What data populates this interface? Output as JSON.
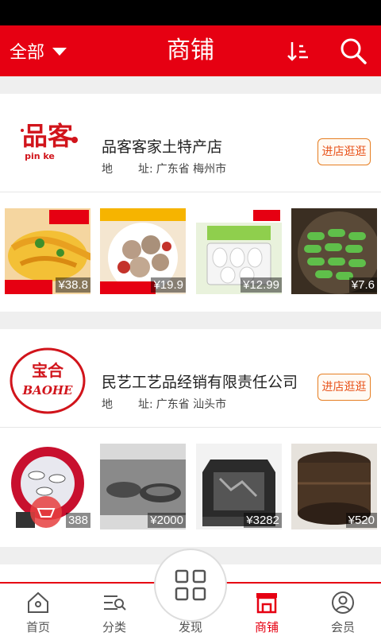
{
  "header": {
    "filter_label": "全部",
    "title": "商铺"
  },
  "shops": [
    {
      "name": "品客客家土特产店",
      "addr_label_1": "地",
      "addr_label_2": "址:",
      "address": "广东省 梅州市",
      "visit_label": "进店逛逛",
      "logo_text": "品客",
      "logo_sub": "pin ke",
      "products": [
        {
          "price": "¥38.8"
        },
        {
          "price": "¥19.9"
        },
        {
          "price": "¥12.99"
        },
        {
          "price": "¥7.6"
        }
      ]
    },
    {
      "name": "民艺工艺品经销有限责任公司",
      "addr_label_1": "地",
      "addr_label_2": "址:",
      "address": "广东省 汕头市",
      "visit_label": "进店逛逛",
      "logo_text": "宝合",
      "logo_sub": "BAOHE",
      "products": [
        {
          "price": "388"
        },
        {
          "price": "¥2000"
        },
        {
          "price": "¥3282"
        },
        {
          "price": "¥520"
        }
      ]
    }
  ],
  "tabs": [
    {
      "label": "首页",
      "icon": "home-icon"
    },
    {
      "label": "分类",
      "icon": "category-icon"
    },
    {
      "label": "发现",
      "icon": "discover-grid-icon"
    },
    {
      "label": "商铺",
      "icon": "shop-icon"
    },
    {
      "label": "会员",
      "icon": "member-icon"
    }
  ],
  "colors": {
    "brand_red": "#e60012",
    "visit_button": "#e8541c"
  }
}
